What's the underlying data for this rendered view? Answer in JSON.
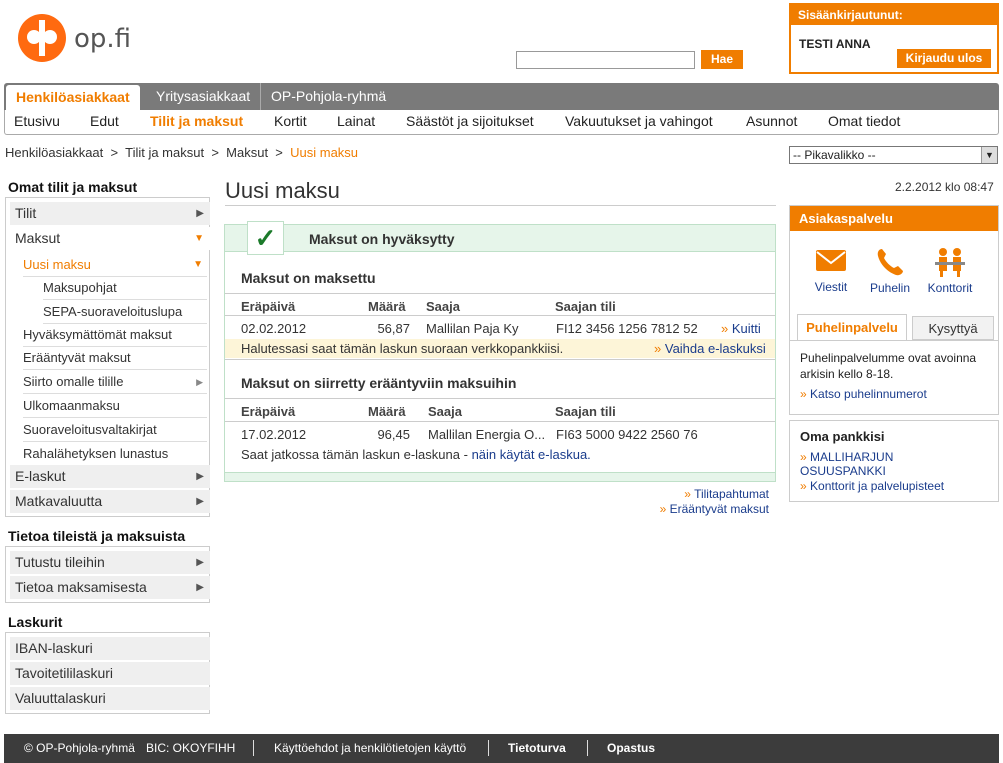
{
  "header": {
    "logo_text": "op.fi",
    "search": {
      "button": "Hae",
      "value": "",
      "placeholder": ""
    },
    "login": {
      "title": "Sisäänkirjautunut:",
      "user": "TESTI ANNA",
      "logout": "Kirjaudu ulos"
    }
  },
  "nav": {
    "tabs": [
      "Henkilöasiakkaat",
      "Yritysasiakkaat",
      "OP-Pohjola-ryhmä"
    ],
    "sub": [
      "Etusivu",
      "Edut",
      "Tilit ja maksut",
      "Kortit",
      "Lainat",
      "Säästöt ja sijoitukset",
      "Vakuutukset ja vahingot",
      "Asunnot",
      "Omat tiedot"
    ]
  },
  "breadcrumb": {
    "items": [
      "Henkilöasiakkaat",
      "Tilit ja maksut",
      "Maksut"
    ],
    "sep": ">",
    "current": "Uusi maksu"
  },
  "quick_menu": {
    "selected": "-- Pikavalikko --"
  },
  "sidebar": {
    "h1": "Omat tilit ja maksut",
    "tilit": "Tilit",
    "maksut": "Maksut",
    "uusi_maksu": "Uusi maksu",
    "maksupohjat": "Maksupohjat",
    "sepa": "SEPA-suoraveloituslupa",
    "sub_items": [
      "Hyväksymättömät maksut",
      "Erääntyvät maksut",
      "Siirto omalle tilille",
      "Ulkomaanmaksu",
      "Suoraveloitusvaltakirjat",
      "Rahalähetyksen lunastus"
    ],
    "elaskut": "E-laskut",
    "matkavaluutta": "Matkavaluutta",
    "h2": "Tietoa tileistä ja maksuista",
    "info_items": [
      "Tutustu tileihin",
      "Tietoa maksamisesta"
    ],
    "h3": "Laskurit",
    "calc_items": [
      "IBAN-laskuri",
      "Tavoitetililaskuri",
      "Valuuttalaskuri"
    ]
  },
  "main": {
    "title": "Uusi maksu",
    "date": "2.2.2012 klo 08:47",
    "message": "Maksut on hyväksytty",
    "check": "✓",
    "section1": {
      "title": "Maksut on maksettu",
      "headers": [
        "Eräpäivä",
        "Määrä",
        "Saaja",
        "Saajan tili"
      ],
      "row": {
        "date": "02.02.2012",
        "amount": "56,87",
        "payee": "Mallilan Paja Ky",
        "account": "FI12 3456 1256 7812 52",
        "link": "Kuitti"
      },
      "info": "Halutessasi saat tämän laskun suoraan verkkopankkiisi.",
      "info_link": "Vaihda e-laskuksi"
    },
    "section2": {
      "title": "Maksut on siirretty erääntyviin maksuihin",
      "headers": [
        "Eräpäivä",
        "Määrä",
        "Saaja",
        "Saajan tili"
      ],
      "row": {
        "date": "17.02.2012",
        "amount": "96,45",
        "payee": "Mallilan Energia O...",
        "account": "FI63 5000 9422 2560 76"
      },
      "info": "Saat jatkossa tämän laskun e-laskuna",
      "info_dash": "-",
      "info_link": "näin käytät e-laskua."
    },
    "links": [
      "Tilitapahtumat",
      "Erääntyvät maksut"
    ],
    "link_marker": "»"
  },
  "right": {
    "cs_title": "Asiakaspalvelu",
    "icons": [
      {
        "label": "Viestit",
        "icon": "envelope-icon"
      },
      {
        "label": "Puhelin",
        "icon": "phone-icon"
      },
      {
        "label": "Konttorit",
        "icon": "office-icon"
      }
    ],
    "tabs": [
      "Puhelinpalvelu",
      "Kysyttyä"
    ],
    "phone_text": "Puhelinpalvelumme ovat avoinna arkisin kello 8-18.",
    "phone_link": "Katso puhelinnumerot",
    "bank_title": "Oma pankkisi",
    "bank_name": "MALLIHARJUN OSUUSPANKKI",
    "bank_link": "Konttorit ja palvelupisteet"
  },
  "footer": {
    "copyright": "© OP-Pohjola-ryhmä",
    "bic": "BIC: OKOYFIHH",
    "links": [
      "Käyttöehdot ja henkilötietojen käyttö",
      "Tietoturva",
      "Opastus"
    ]
  },
  "colors": {
    "accent": "#f07d00",
    "link": "#1a3c8c",
    "success_bg": "#e6f5ea",
    "footer_bg": "#3c3c3c"
  }
}
